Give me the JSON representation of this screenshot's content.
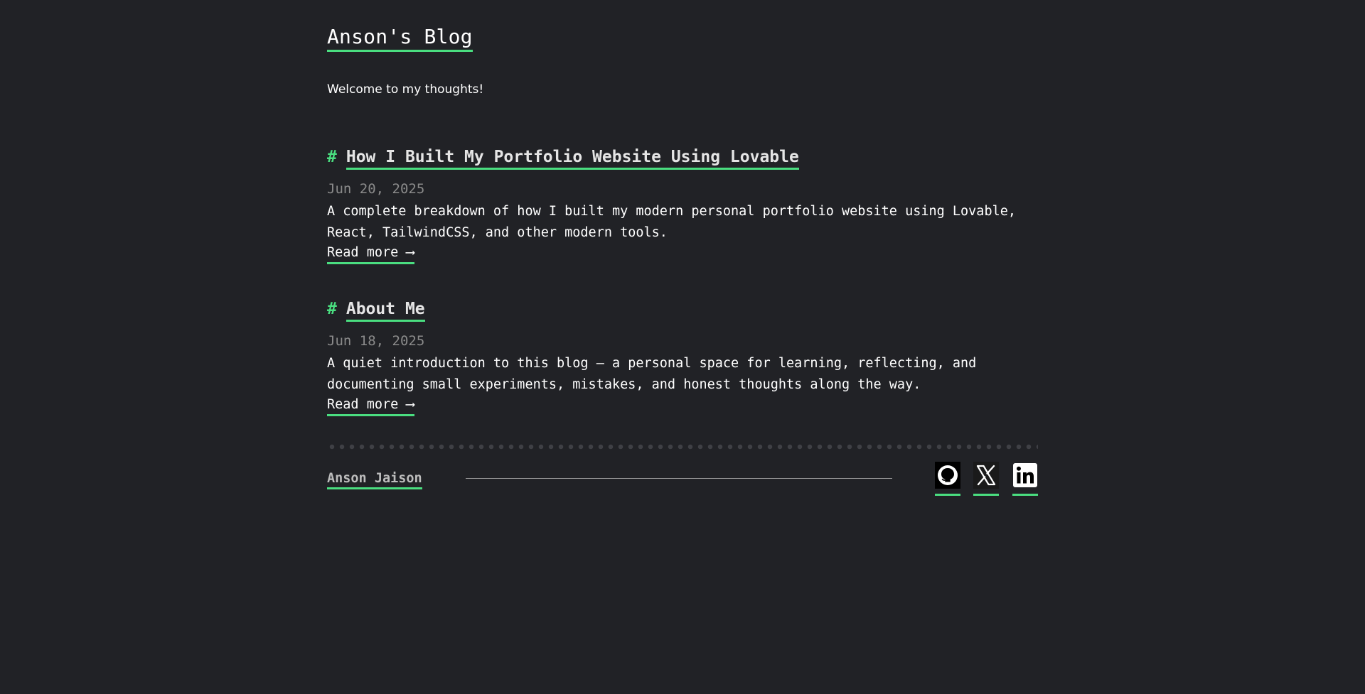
{
  "header": {
    "site_title": "Anson's Blog",
    "tagline": "Welcome to my thoughts!"
  },
  "posts": [
    {
      "hash": "#",
      "title": "How I Built My Portfolio Website Using Lovable",
      "date": "Jun 20, 2025",
      "excerpt": "A complete breakdown of how I built my modern personal portfolio website using Lovable, React, TailwindCSS, and other modern tools.",
      "read_more": "Read more ⟶"
    },
    {
      "hash": "#",
      "title": "About Me",
      "date": "Jun 18, 2025",
      "excerpt": "A quiet introduction to this blog — a personal space for learning, reflecting, and documenting small experiments, mistakes, and honest thoughts along the way.",
      "read_more": "Read more ⟶"
    }
  ],
  "footer": {
    "author": "Anson Jaison",
    "social_icons": [
      "github-icon",
      "x-icon",
      "linkedin-icon"
    ]
  },
  "colors": {
    "background": "#212226",
    "accent": "#4ade80",
    "text": "#ffffff",
    "muted": "#8a8a8a"
  }
}
